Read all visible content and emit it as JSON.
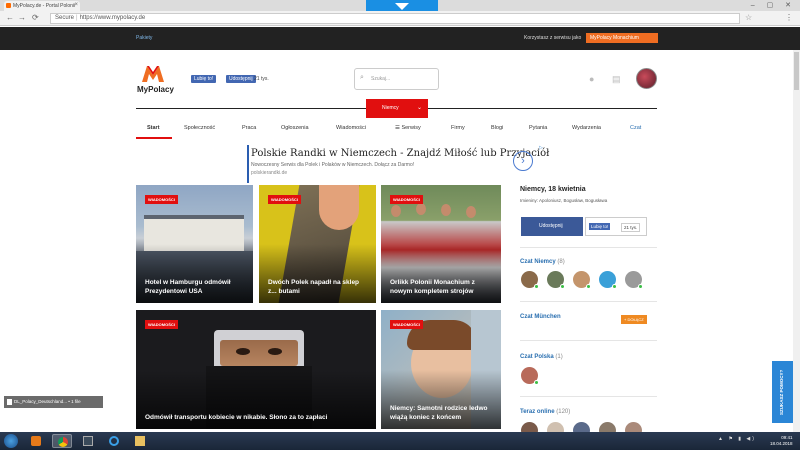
{
  "browser": {
    "tab_title": "MyPolacy.de - Portal Polonii",
    "url_secure_label": "Secure",
    "url": "https://www.mypolacy.de",
    "tab_close": "×",
    "window_controls": "– ▢ ✕",
    "nav_back": "←",
    "nav_forward": "→",
    "nav_reload": "⟳",
    "star_icon": "☆",
    "menu_icon": "⋮"
  },
  "site_topbar": {
    "link": "Pakiety",
    "using_label": "Korzystasz z serwisu jako",
    "city_label": "MyPolacy Monachium"
  },
  "header": {
    "logo_text": "MyPolacy",
    "fb_like": "Lubię to!",
    "fb_share": "Udostępnij",
    "fb_count": "21 tys.",
    "search_placeholder": "Szukaj...",
    "search_icon": "⌕",
    "bell_icon": "●",
    "chat_icon": "▤",
    "country_select": "Niemcy",
    "chevron": "⌄"
  },
  "mainnav": {
    "items": [
      {
        "label": "Start",
        "active": true
      },
      {
        "label": "Społeczność"
      },
      {
        "label": "Praca"
      },
      {
        "label": "Ogłoszenia"
      },
      {
        "label": "Wiadomości"
      },
      {
        "label": "☰ Serwisy"
      },
      {
        "label": "Firmy"
      },
      {
        "label": "Blogi"
      },
      {
        "label": "Pytania"
      },
      {
        "label": "Wydarzenia"
      },
      {
        "label": "Czat",
        "link": true
      }
    ]
  },
  "ad": {
    "title": "Polskie Randki w Niemczech - Znajdź Miłość lub Przyjaciół",
    "description": "Nowoczesny Serwis dla Polek i Polaków w Niemczech. Dołącz za Darmo!",
    "url": "polskierandki.de",
    "arrow": "›",
    "ad_choice": "▷"
  },
  "news": [
    {
      "badge": "WIADOMOŚCI",
      "title": "Hotel w Hamburgu odmówił Prezydentowi USA"
    },
    {
      "badge": "WIADOMOŚCI",
      "title": "Dwóch Polek napadł na sklep z... butami"
    },
    {
      "badge": "WIADOMOŚCI",
      "title": "Orlikk Polonii Monachium z nowym kompletem strojów"
    },
    {
      "badge": "WIADOMOŚCI",
      "title": "Odmówił transportu kobiecie w nikabie. Słono za to zapłaci"
    },
    {
      "badge": "WIADOMOŚCI",
      "title": "Niemcy: Samotni rodzice ledwo wiążą koniec z końcem"
    }
  ],
  "sidebar": {
    "date": "Niemcy, 18 kwietnia",
    "names": "Imieniny: Apoloniusz, Bogusław, Bogusława",
    "fb_button": "Udostępnij",
    "fb_like": "Lubię to!",
    "fb_count": "21 tys.",
    "czat_niemcy": {
      "title": "Czat Niemcy",
      "count": "(8)"
    },
    "czat_munchen": {
      "title": "Czat München",
      "join": "+ DOŁĄCZ"
    },
    "czat_polska": {
      "title": "Czat Polska",
      "count": "(1)"
    },
    "online_now": {
      "title": "Teraz online",
      "count": "(120)"
    },
    "help_button": "SZUKASZ POMOCY?"
  },
  "download_shelf": {
    "file": "DL_Polacy_Deutschland... • 1 file"
  },
  "taskbar": {
    "tray": "▲ ⚑ ▮ ◀)",
    "time": "09:41",
    "date": "18.04.2018"
  },
  "colors": {
    "brand_red": "#e10f0f",
    "brand_orange": "#ef6d22",
    "link_blue": "#2a6fb0",
    "facebook": "#3b5998"
  }
}
